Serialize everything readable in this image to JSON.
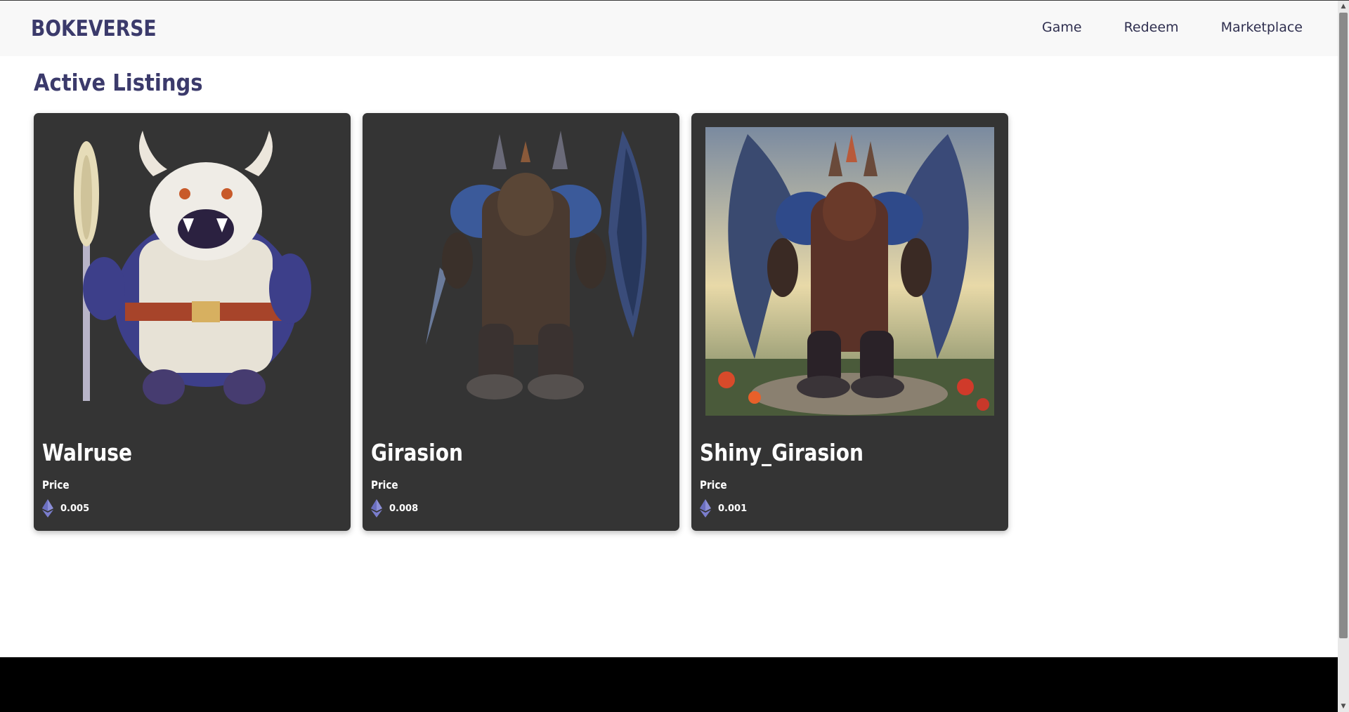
{
  "navbar": {
    "logo": "BOKEVERSE",
    "links": [
      {
        "label": "Game"
      },
      {
        "label": "Redeem"
      },
      {
        "label": "Marketplace"
      }
    ]
  },
  "main": {
    "heading": "Active Listings",
    "listings": [
      {
        "name": "Walruse",
        "price_label": "Price",
        "price": "0.005",
        "currency_icon": "ethereum-icon"
      },
      {
        "name": "Girasion",
        "price_label": "Price",
        "price": "0.008",
        "currency_icon": "ethereum-icon"
      },
      {
        "name": "Shiny_Girasion",
        "price_label": "Price",
        "price": "0.001",
        "currency_icon": "ethereum-icon"
      }
    ]
  },
  "colors": {
    "brand": "#3b3a6b",
    "card_bg": "#343434",
    "navbar_bg": "#f8f8f8",
    "footer_bg": "#000000"
  }
}
